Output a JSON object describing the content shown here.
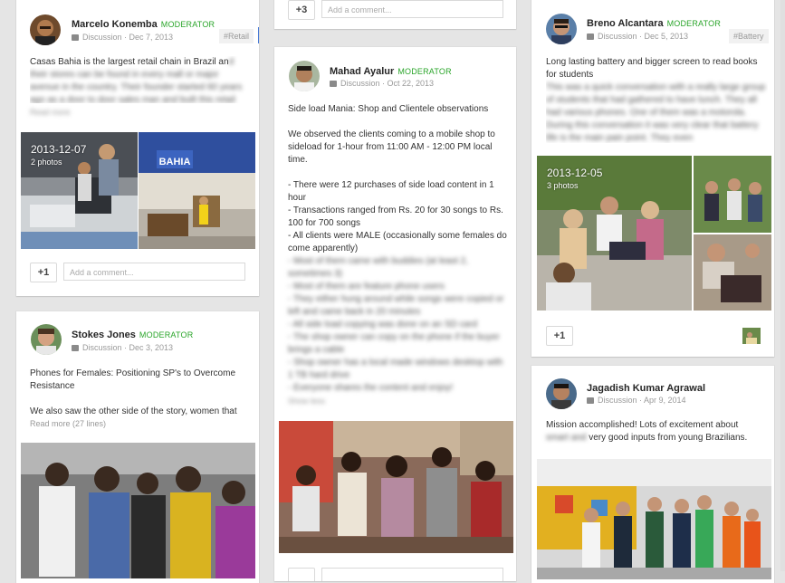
{
  "colors": {
    "moderator": "#2aa52a",
    "accent": "#4a7bd6",
    "background": "#e5e5e5"
  },
  "top_card": {
    "plus_label": "+3",
    "comment_placeholder": "Add a comment..."
  },
  "posts": {
    "marcelo": {
      "author": "Marcelo Konemba",
      "role": "MODERATOR",
      "category": "Discussion",
      "date": "Dec 7, 2013",
      "tag": "#Retail",
      "text": "Casas Bahia is the largest retail chain in Brazil and their stores can be found in every mall or major avenue in the country. Their founder started 60 years ago as a door to door sales man and built this retail",
      "read_more": "Read more",
      "album_date": "2013-12-07",
      "album_count": "2 photos",
      "plus_label": "+1",
      "comment_placeholder": "Add a comment..."
    },
    "stokes": {
      "author": "Stokes Jones",
      "role": "MODERATOR",
      "category": "Discussion",
      "date": "Dec 3, 2013",
      "title": "Phones for Females: Positioning SP's to Overcome Resistance",
      "text": "We also saw the other side of the story, women that",
      "read_more": "Read more (27 lines)"
    },
    "mahad": {
      "author": "Mahad Ayalur",
      "role": "MODERATOR",
      "category": "Discussion",
      "date": "Oct 22, 2013",
      "title": "Side load Mania: Shop and Clientele observations",
      "intro": "We observed the clients coming to a mobile shop to sideload for 1-hour from 11:00 AM - 12:00 PM local time.",
      "bullet_1": "- There were 12 purchases of side load content in 1 hour",
      "bullet_2": "- Transactions ranged from Rs. 20 for 30 songs to Rs. 100 for 700 songs",
      "bullet_3": "- All clients were MALE (occasionally some females do come apparently)",
      "bullet_4": "- Most of them came with buddies (at least 2, sometimes 3)",
      "bullet_5": "- Most of them are feature phone users",
      "bullet_6": "- They either hung around while songs were copied or left and came back in 20 minutes",
      "bullet_7": "- All side load copying was done on an SD card",
      "bullet_8": "- The shop owner can copy on the phone if the buyer brings a cable",
      "bullet_9": "- Shop owner has a local made windows desktop with 1 TB hard drive",
      "bullet_10": "- Everyone shares the content and enjoy!",
      "show_less": "Show less"
    },
    "breno": {
      "author": "Breno Alcantara",
      "role": "MODERATOR",
      "category": "Discussion",
      "date": "Dec 5, 2013",
      "tag": "#Battery",
      "title": "Long lasting battery and bigger screen to read books for students",
      "text": "This was a quick conversation with a really large group of students that had gathered to have lunch. They all had various phones. One of them was a motorola. During this conversation it was very clear that battery life is the main pain point. They even",
      "album_date": "2013-12-05",
      "album_count": "3 photos",
      "plus_label": "+1"
    },
    "jagadish": {
      "author": "Jagadish Kumar Agrawal",
      "category": "Discussion",
      "date": "Apr 9, 2014",
      "text_a": "Mission accomplished! Lots of excitement about",
      "text_blur": "smart and",
      "text_b": "very good inputs from young Brazilians."
    }
  }
}
